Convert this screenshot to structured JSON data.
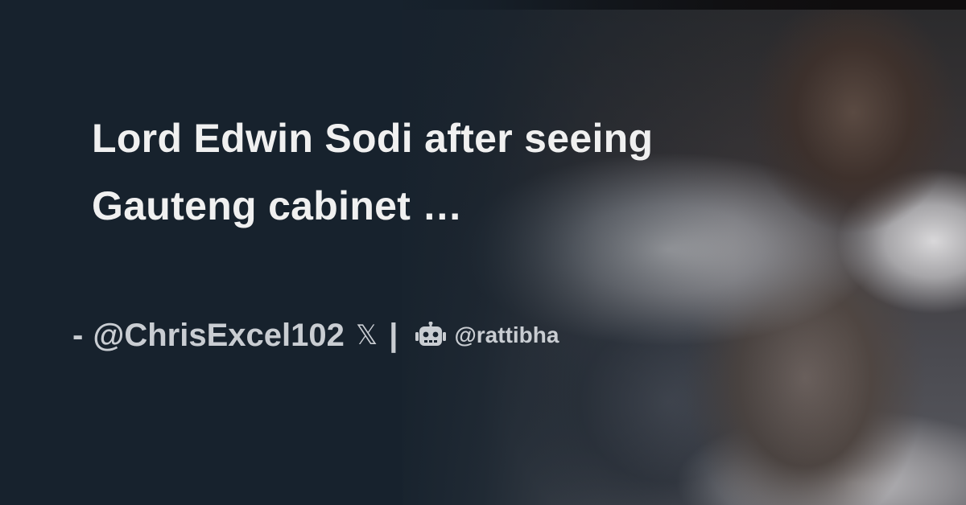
{
  "post": {
    "title": "Lord Edwin Sodi after seeing Gauteng cabinet …",
    "byline_dash": "-",
    "author_handle": "@ChrisExcel102",
    "platform_icon": "x-logo-icon",
    "separator": "|",
    "site_icon": "robot-icon",
    "site_handle": "@rattibha"
  },
  "colors": {
    "background": "#17222d",
    "title_text": "#f0f0f0",
    "byline_text": "#c9cdd2"
  }
}
